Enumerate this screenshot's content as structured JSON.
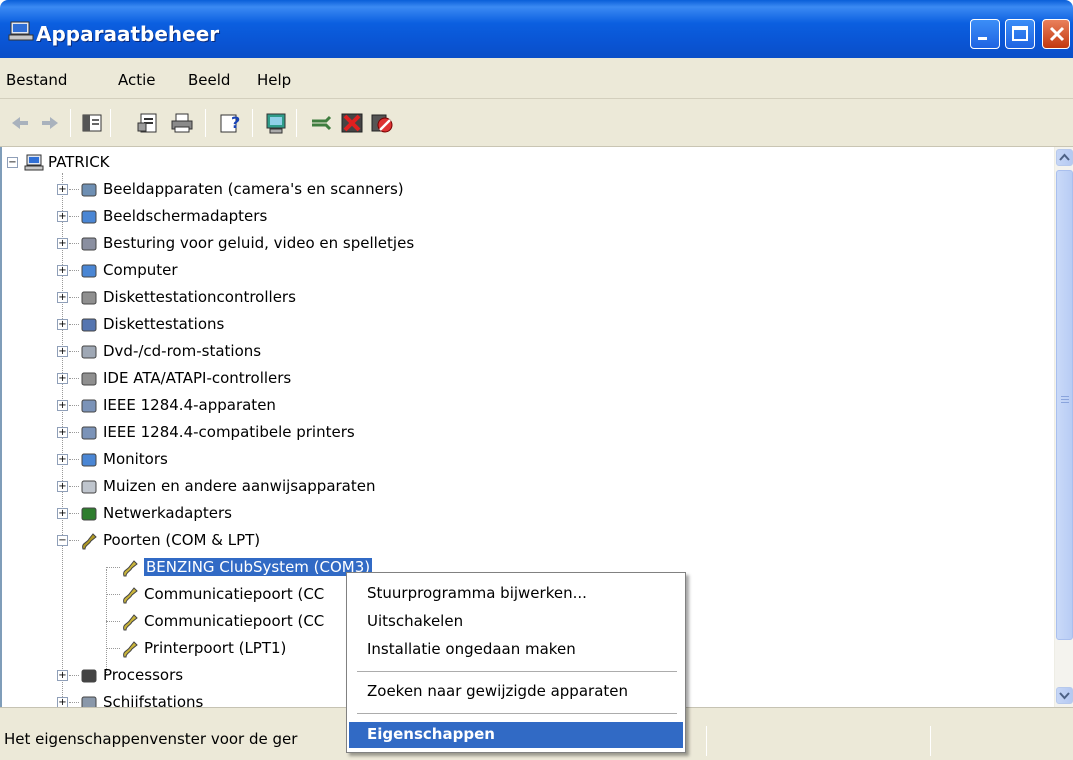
{
  "window": {
    "title": "Apparaatbeheer"
  },
  "menubar": {
    "items": [
      "Bestand",
      "Actie",
      "Beeld",
      "Help"
    ]
  },
  "toolbar": {
    "buttons": [
      "back-icon",
      "forward-icon",
      "console-tree-icon",
      "properties-icon",
      "print-icon",
      "help-icon",
      "scan-hardware-icon",
      "update-driver-icon",
      "uninstall-icon",
      "disable-icon"
    ]
  },
  "tree": {
    "root": "PATRICK",
    "categories": [
      "Beeldapparaten (camera's en scanners)",
      "Beeldschermadapters",
      "Besturing voor geluid, video en spelletjes",
      "Computer",
      "Diskettestationcontrollers",
      "Diskettestations",
      "Dvd-/cd-rom-stations",
      "IDE ATA/ATAPI-controllers",
      "IEEE 1284.4-apparaten",
      "IEEE 1284.4-compatibele printers",
      "Monitors",
      "Muizen en andere aanwijsapparaten",
      "Netwerkadapters",
      "Poorten (COM & LPT)"
    ],
    "ports": [
      "BENZING ClubSystem (COM3)",
      "Communicatiepoort (CC",
      "Communicatiepoort (CC",
      "Printerpoort (LPT1)"
    ],
    "after": [
      "Processors",
      "Schijfstations"
    ]
  },
  "context_menu": {
    "items": [
      "Stuurprogramma bijwerken...",
      "Uitschakelen",
      "Installatie ongedaan maken",
      "Zoeken naar gewijzigde apparaten",
      "Eigenschappen"
    ]
  },
  "statusbar": {
    "text": "Het eigenschappenvenster voor de ger"
  }
}
